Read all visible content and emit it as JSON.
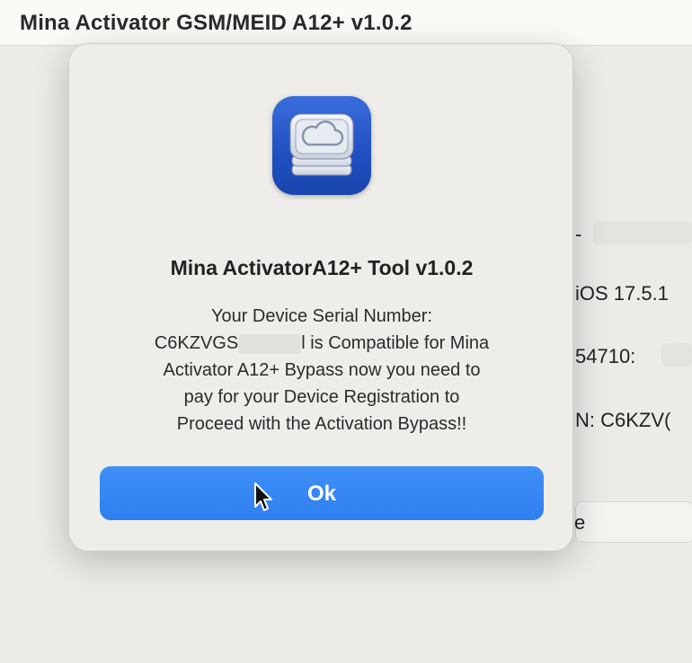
{
  "window": {
    "title": "Mina Activator GSM/MEID A12+ v1.0.2"
  },
  "background_fields": {
    "model_fragment": "-",
    "ios_version": "iOS 17.5.1",
    "imei_fragment": "54710:",
    "serial_fragment": "N: C6KZV(",
    "field_fragment": "e"
  },
  "dialog": {
    "app_icon": "cloud-drive-stack-icon",
    "title": "Mina ActivatorA12+ Tool v1.0.2",
    "message_lines": {
      "line1": "Your Device Serial Number:",
      "line2_prefix": "C6KZVGS",
      "line2_suffix": "l is Compatible for Mina",
      "line3": "Activator A12+ Bypass now you need to",
      "line4": "pay for your Device Registration to",
      "line5": "Proceed with the Activation Bypass!!"
    },
    "ok_label": "Ok"
  },
  "colors": {
    "accent": "#2f7ff0",
    "icon_blue": "#1f4fc0"
  }
}
